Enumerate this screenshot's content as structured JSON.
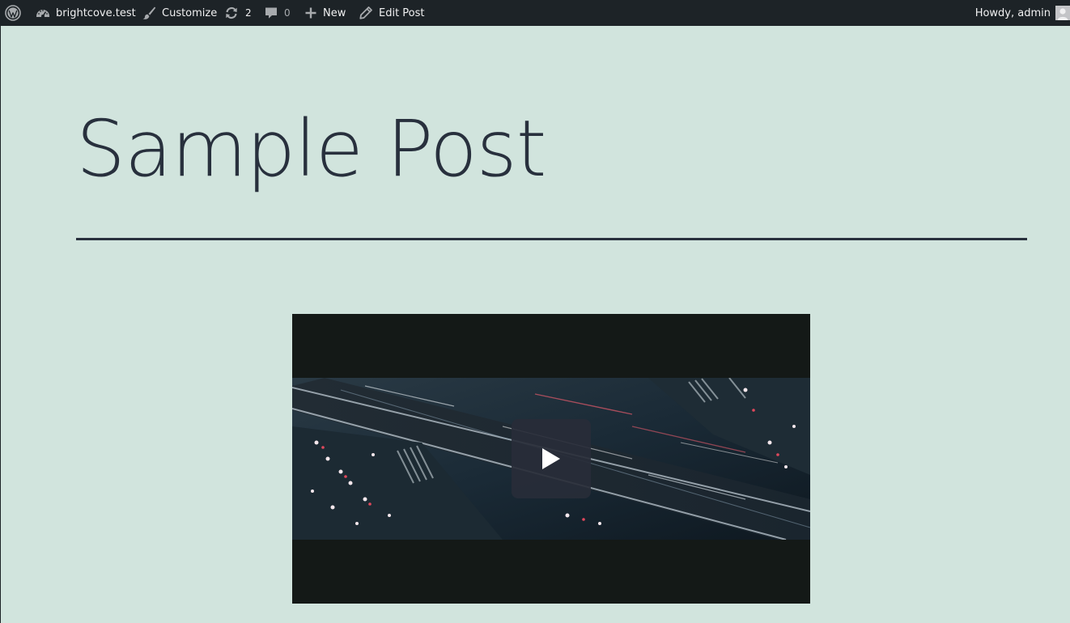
{
  "admin_bar": {
    "wp_logo_icon": "wordpress-logo-icon",
    "site_name": "brightcove.test",
    "site_icon": "dashboard-icon",
    "customize_label": "Customize",
    "customize_icon": "paintbrush-icon",
    "updates_count": "2",
    "updates_icon": "update-icon",
    "comments_count": "0",
    "comments_icon": "comment-icon",
    "new_label": "New",
    "new_icon": "plus-icon",
    "edit_label": "Edit Post",
    "edit_icon": "pencil-icon",
    "account_label": "Howdy, admin",
    "avatar_icon": "avatar-icon",
    "bar_color": "#1d2327"
  },
  "post": {
    "title": "Sample Post",
    "background_color": "#d1e4dd",
    "text_color": "#28303d"
  },
  "video": {
    "play_icon": "play-icon",
    "letterbox_color": "#141917"
  }
}
